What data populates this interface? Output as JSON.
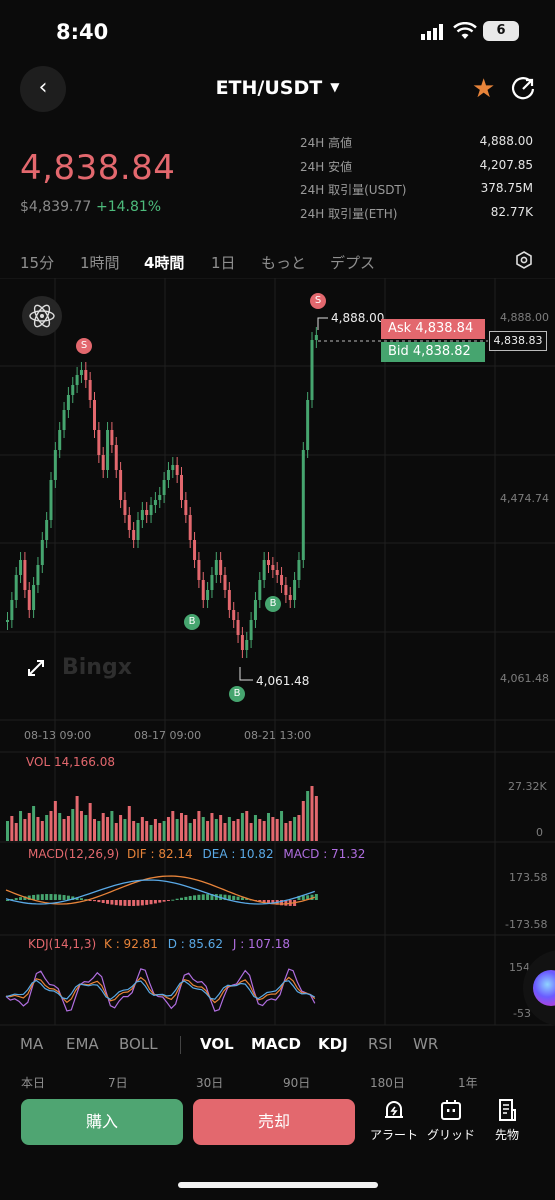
{
  "status_bar": {
    "time": "8:40",
    "battery": "6"
  },
  "header": {
    "pair": "ETH/USDT",
    "caret": "▼",
    "back_icon": "‹",
    "star_icon": "★"
  },
  "ticker": {
    "price": "4,838.84",
    "usd_value": "$4,839.77",
    "change": "+14.81%",
    "stats": [
      {
        "label": "24H 高値",
        "value": "4,888.00"
      },
      {
        "label": "24H 安値",
        "value": "4,207.85"
      },
      {
        "label": "24H 取引量(USDT)",
        "value": "378.75M"
      },
      {
        "label": "24H 取引量(ETH)",
        "value": "82.77K"
      }
    ]
  },
  "timeframes": [
    "15分",
    "1時間",
    "4時間",
    "1日",
    "もっと",
    "デプス"
  ],
  "active_timeframe": "4時間",
  "chart": {
    "y_axis_labels": [
      "4,888.00",
      "4,474.74",
      "4,061.48"
    ],
    "ask_label": "Ask 4,838.84",
    "bid_label": "Bid 4,838.82",
    "last_price_label": "4,838.83",
    "high_marker": "4,888.00",
    "low_marker": "4,061.48",
    "date_labels": [
      "08-13 09:00",
      "08-17 09:00",
      "08-21 13:00"
    ],
    "watermark": "Bingx",
    "sell_marker": "S",
    "buy_marker": "B"
  },
  "indicators": {
    "vol": {
      "title": "VOL 14,166.08",
      "axis_top": "27.32K",
      "axis_bottom": "0"
    },
    "macd": {
      "name": "MACD(12,26,9)",
      "dif": "DIF : 82.14",
      "dea": "DEA : 10.82",
      "macd": "MACD : 71.32",
      "axis_top": "173.58",
      "axis_bottom": "-173.58"
    },
    "kdj": {
      "name": "KDJ(14,1,3)",
      "k": "K : 92.81",
      "d": "D : 85.62",
      "j": "J : 107.18",
      "axis_top": "154.85",
      "axis_bottom": "-53"
    }
  },
  "indicator_tabs": [
    "MA",
    "EMA",
    "BOLL",
    "VOL",
    "MACD",
    "KDJ",
    "RSI",
    "WR"
  ],
  "active_indicator_tabs": [
    "VOL",
    "MACD",
    "KDJ"
  ],
  "ranges": [
    "本日",
    "7日",
    "30日",
    "90日",
    "180日",
    "1年"
  ],
  "actions": {
    "buy": "購入",
    "sell": "売却",
    "tools": [
      {
        "label": "アラート",
        "icon": "alarm-icon"
      },
      {
        "label": "グリッド",
        "icon": "grid-bot-icon"
      },
      {
        "label": "先物",
        "icon": "futures-doc-icon"
      }
    ]
  },
  "colors": {
    "up": "#46a56f",
    "down": "#e3686e",
    "accent": "#e8843a",
    "dif": "#e8843a",
    "dea": "#5aa9e6",
    "macd": "#b06ee0"
  }
}
